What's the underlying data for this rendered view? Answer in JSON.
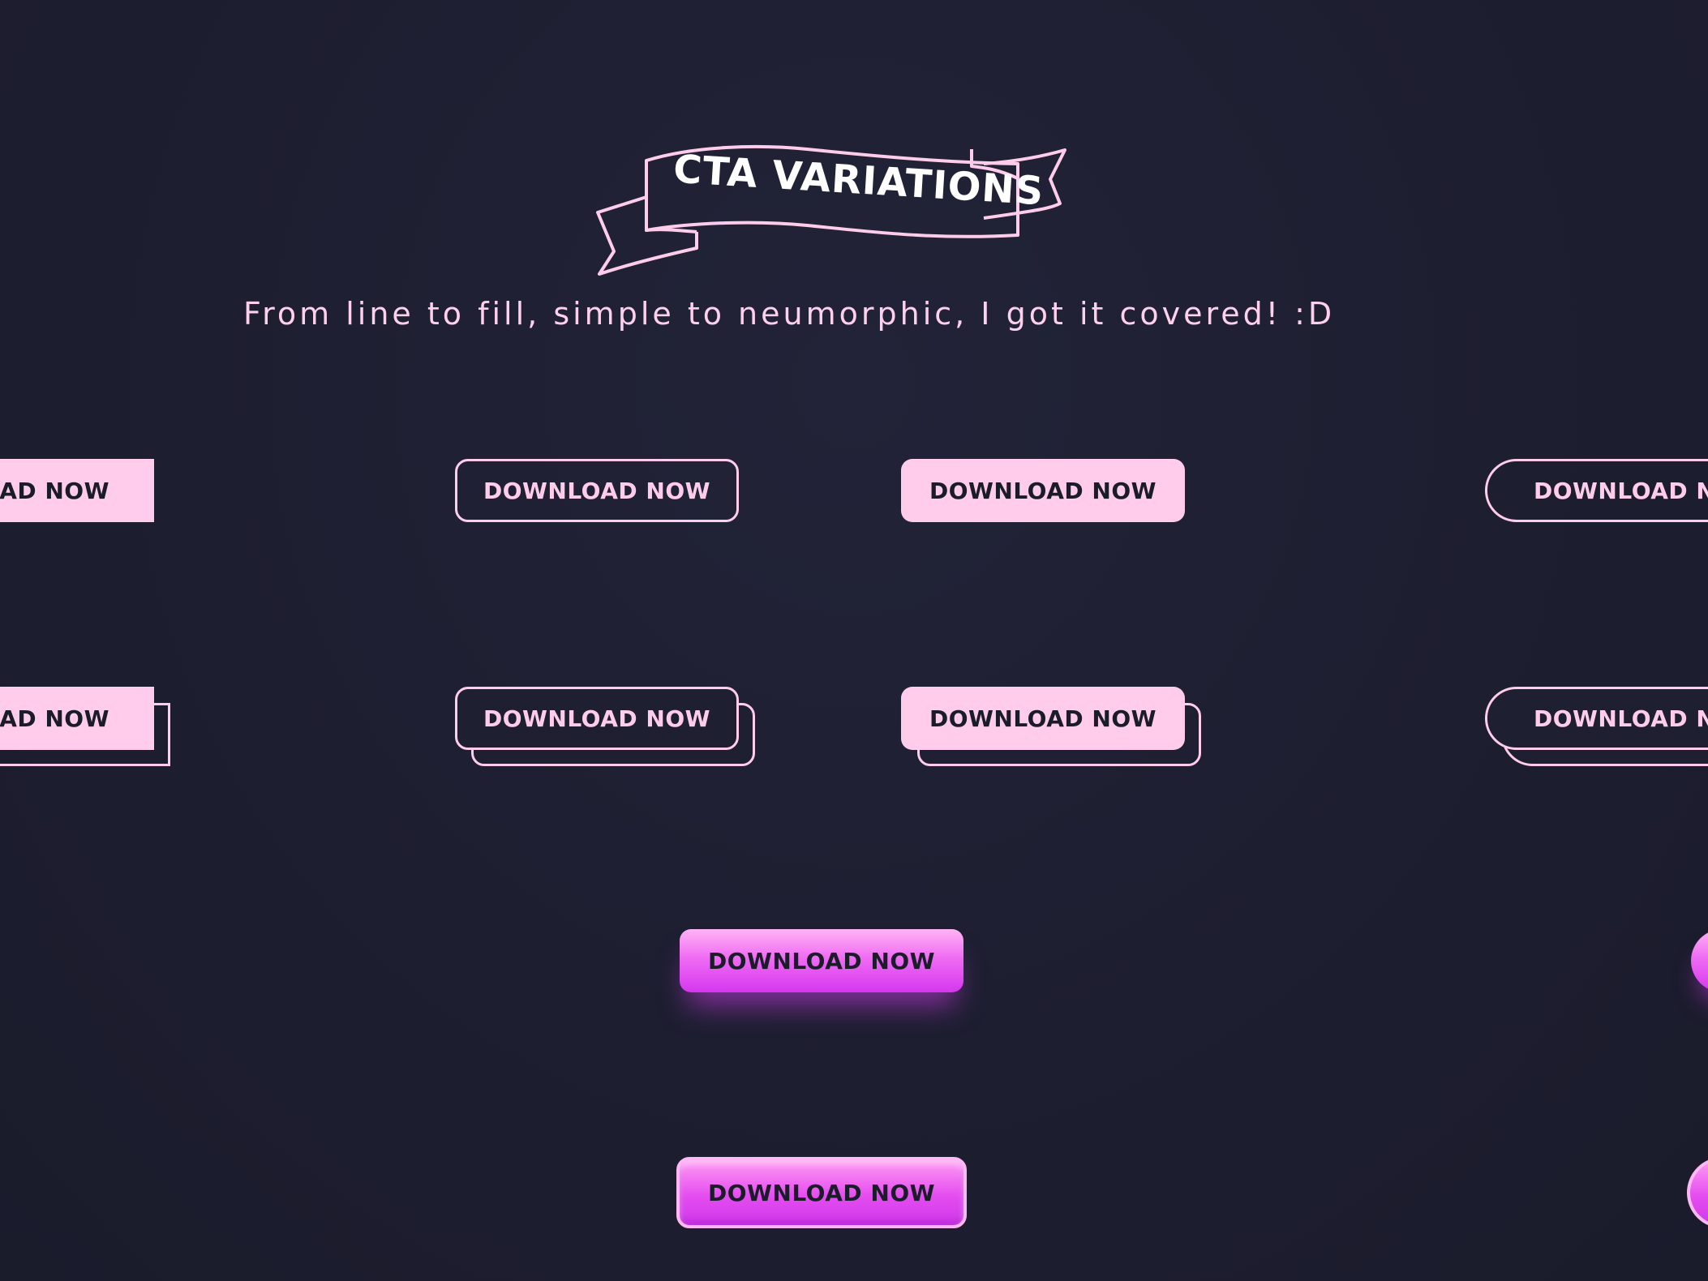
{
  "header": {
    "title": "CTA VARIATIONS",
    "subtitle": "From line to fill, simple to neumorphic, I got it covered! :D"
  },
  "buttons": {
    "row1": {
      "sharp_fill": "DOWNLOAD NOW",
      "rounded_outline": "DOWNLOAD NOW",
      "rounded_fill": "DOWNLOAD NOW",
      "pill_outline": "DOWNLOAD NOW"
    },
    "row2": {
      "sharp_fill_offset": "DOWNLOAD NOW",
      "rounded_outline_offset": "DOWNLOAD NOW",
      "rounded_fill_offset": "DOWNLOAD NOW",
      "pill_outline_offset": "DOWNLOAD NOW"
    },
    "row3": {
      "gradient_glow": "DOWNLOAD NOW"
    },
    "row4": {
      "neumorphic": "DOWNLOAD NOW"
    }
  },
  "colors": {
    "background": "#1e1f31",
    "accent_pink": "#ffcdeb",
    "gradient_magenta": "#d437ee",
    "text_dark": "#1b1c2a"
  }
}
